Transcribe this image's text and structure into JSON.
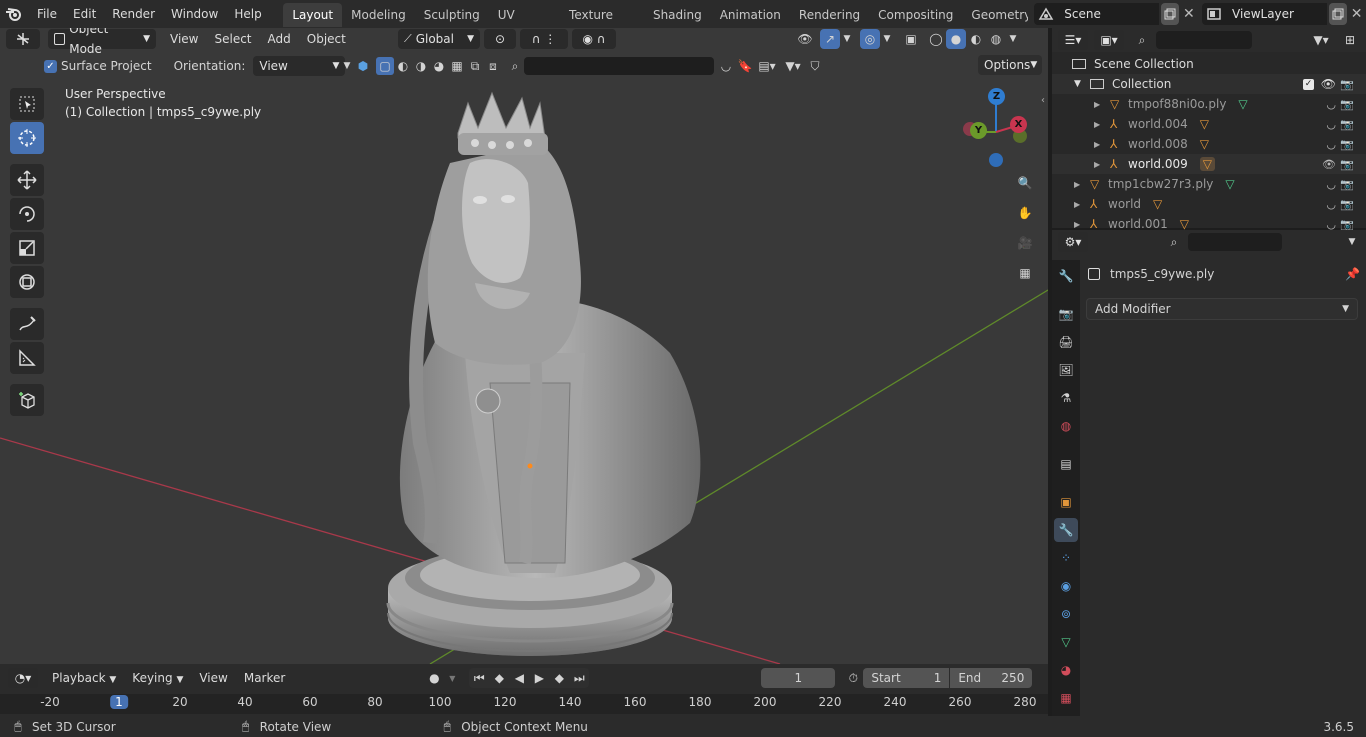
{
  "menu": {
    "file": "File",
    "edit": "Edit",
    "render": "Render",
    "window": "Window",
    "help": "Help"
  },
  "workspaces": [
    "Layout",
    "Modeling",
    "Sculpting",
    "UV Editing",
    "Texture Paint",
    "Shading",
    "Animation",
    "Rendering",
    "Compositing",
    "Geometry Noc"
  ],
  "scene": {
    "name": "Scene",
    "view_layer": "ViewLayer"
  },
  "viewport": {
    "mode": "Object Mode",
    "view": "View",
    "select": "Select",
    "add": "Add",
    "object": "Object",
    "transform_orientation": "Global",
    "surface_project": "Surface Project",
    "orientation_label": "Orientation:",
    "orientation_value": "View",
    "options": "Options",
    "info_line1": "User Perspective",
    "info_line2": "(1) Collection | tmps5_c9ywe.ply",
    "gizmo": {
      "z": "Z",
      "y": "Y",
      "x": "X"
    }
  },
  "outliner": {
    "scene_collection": "Scene Collection",
    "collection": "Collection",
    "items": [
      {
        "name": "tmpof88ni0o.ply",
        "type": "mesh",
        "indent": 2,
        "visible": false
      },
      {
        "name": "world.004",
        "type": "empty",
        "indent": 2,
        "visible": false
      },
      {
        "name": "world.008",
        "type": "empty",
        "indent": 2,
        "visible": false
      },
      {
        "name": "world.009",
        "type": "empty",
        "indent": 2,
        "visible": true
      },
      {
        "name": "tmp1cbw27r3.ply",
        "type": "mesh",
        "indent": 1,
        "visible": false
      },
      {
        "name": "world",
        "type": "empty",
        "indent": 1,
        "visible": false
      },
      {
        "name": "world.001",
        "type": "empty",
        "indent": 1,
        "visible": false
      }
    ]
  },
  "properties": {
    "object_name": "tmps5_c9ywe.ply",
    "add_modifier": "Add Modifier"
  },
  "timeline": {
    "playback": "Playback",
    "keying": "Keying",
    "view": "View",
    "marker": "Marker",
    "current_frame": "1",
    "start_label": "Start",
    "start": "1",
    "end_label": "End",
    "end": "250",
    "ruler": [
      "-20",
      "1",
      "20",
      "40",
      "60",
      "80",
      "100",
      "120",
      "140",
      "160",
      "180",
      "200",
      "220",
      "240",
      "260",
      "280"
    ]
  },
  "status": {
    "left": "Set 3D Cursor",
    "middle": "Rotate View",
    "right": "Object Context Menu",
    "version": "3.6.5"
  },
  "colors": {
    "accent": "#4772b3",
    "x_axis": "#c8354f",
    "y_axis": "#6b9a2a",
    "z_axis": "#2f7dd1",
    "empty_orange": "#e0953a",
    "mesh_green": "#52c78a"
  }
}
